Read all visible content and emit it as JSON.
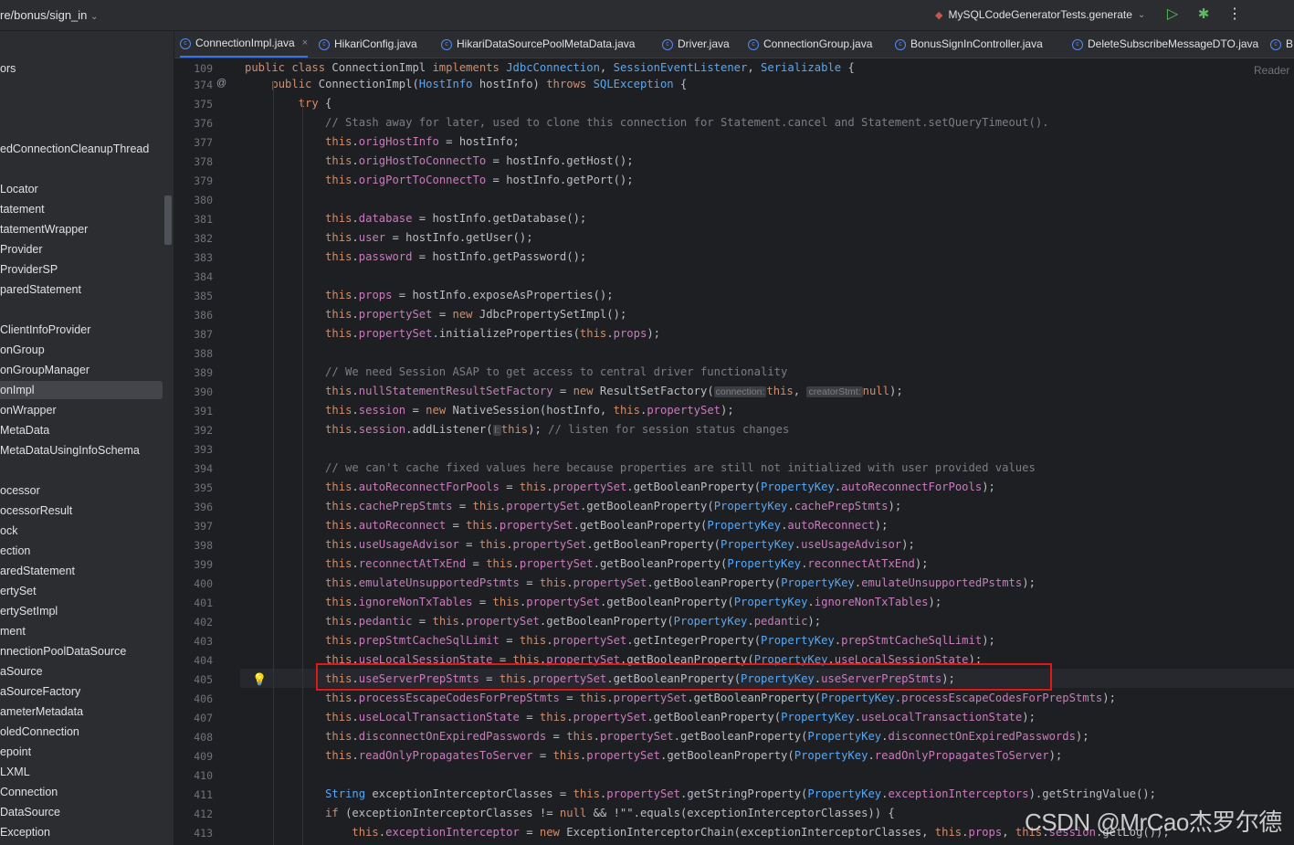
{
  "topbar": {
    "branch": "re/bonus/sign_in",
    "run_config": "MySQLCodeGeneratorTests.generate"
  },
  "sidebar": {
    "items": [
      "ors",
      "",
      "",
      "",
      "edConnectionCleanupThread",
      "",
      "Locator",
      "tatement",
      "tatementWrapper",
      "Provider",
      "ProviderSP",
      "paredStatement",
      "",
      "ClientInfoProvider",
      "onGroup",
      "onGroupManager",
      "onImpl",
      "onWrapper",
      "MetaData",
      "MetaDataUsingInfoSchema",
      "",
      "ocessor",
      "ocessorResult",
      "ock",
      "ection",
      "aredStatement",
      "ertySet",
      "ertySetImpl",
      "ment",
      "nnectionPoolDataSource",
      "aSource",
      "aSourceFactory",
      "ameterMetadata",
      "oledConnection",
      "epoint",
      "LXML",
      "Connection",
      "DataSource",
      "Exception"
    ],
    "selected_index": 16
  },
  "tabs": [
    {
      "label": "ConnectionImpl.java",
      "active": true
    },
    {
      "label": "HikariConfig.java",
      "active": false
    },
    {
      "label": "HikariDataSourcePoolMetaData.java",
      "active": false
    },
    {
      "label": "Driver.java",
      "active": false
    },
    {
      "label": "ConnectionGroup.java",
      "active": false
    },
    {
      "label": "BonusSignInController.java",
      "active": false
    },
    {
      "label": "DeleteSubscribeMessageDTO.java",
      "active": false
    },
    {
      "label": "B",
      "active": false
    }
  ],
  "editor": {
    "reader_mode": "Reader",
    "watermark": "CSDN @MrCao杰罗尔德",
    "lines": [
      {
        "n": "109",
        "text": "public class ConnectionImpl implements JdbcConnection, SessionEventListener, Serializable {"
      },
      {
        "n": "374",
        "text": "    public ConnectionImpl(HostInfo hostInfo) throws SQLException {"
      },
      {
        "n": "375",
        "text": "        try {"
      },
      {
        "n": "376",
        "text": "            // Stash away for later, used to clone this connection for Statement.cancel and Statement.setQueryTimeout()."
      },
      {
        "n": "377",
        "text": "            this.origHostInfo = hostInfo;"
      },
      {
        "n": "378",
        "text": "            this.origHostToConnectTo = hostInfo.getHost();"
      },
      {
        "n": "379",
        "text": "            this.origPortToConnectTo = hostInfo.getPort();"
      },
      {
        "n": "380",
        "text": ""
      },
      {
        "n": "381",
        "text": "            this.database = hostInfo.getDatabase();"
      },
      {
        "n": "382",
        "text": "            this.user = hostInfo.getUser();"
      },
      {
        "n": "383",
        "text": "            this.password = hostInfo.getPassword();"
      },
      {
        "n": "384",
        "text": ""
      },
      {
        "n": "385",
        "text": "            this.props = hostInfo.exposeAsProperties();"
      },
      {
        "n": "386",
        "text": "            this.propertySet = new JdbcPropertySetImpl();"
      },
      {
        "n": "387",
        "text": "            this.propertySet.initializeProperties(this.props);"
      },
      {
        "n": "388",
        "text": ""
      },
      {
        "n": "389",
        "text": "            // We need Session ASAP to get access to central driver functionality"
      },
      {
        "n": "390",
        "text": "            this.nullStatementResultSetFactory = new ResultSetFactory( connection: this,  creatorStmt: null);"
      },
      {
        "n": "391",
        "text": "            this.session = new NativeSession(hostInfo, this.propertySet);"
      },
      {
        "n": "392",
        "text": "            this.session.addListener( l: this); // listen for session status changes"
      },
      {
        "n": "393",
        "text": ""
      },
      {
        "n": "394",
        "text": "            // we can't cache fixed values here because properties are still not initialized with user provided values"
      },
      {
        "n": "395",
        "text": "            this.autoReconnectForPools = this.propertySet.getBooleanProperty(PropertyKey.autoReconnectForPools);"
      },
      {
        "n": "396",
        "text": "            this.cachePrepStmts = this.propertySet.getBooleanProperty(PropertyKey.cachePrepStmts);"
      },
      {
        "n": "397",
        "text": "            this.autoReconnect = this.propertySet.getBooleanProperty(PropertyKey.autoReconnect);"
      },
      {
        "n": "398",
        "text": "            this.useUsageAdvisor = this.propertySet.getBooleanProperty(PropertyKey.useUsageAdvisor);"
      },
      {
        "n": "399",
        "text": "            this.reconnectAtTxEnd = this.propertySet.getBooleanProperty(PropertyKey.reconnectAtTxEnd);"
      },
      {
        "n": "400",
        "text": "            this.emulateUnsupportedPstmts = this.propertySet.getBooleanProperty(PropertyKey.emulateUnsupportedPstmts);"
      },
      {
        "n": "401",
        "text": "            this.ignoreNonTxTables = this.propertySet.getBooleanProperty(PropertyKey.ignoreNonTxTables);"
      },
      {
        "n": "402",
        "text": "            this.pedantic = this.propertySet.getBooleanProperty(PropertyKey.pedantic);"
      },
      {
        "n": "403",
        "text": "            this.prepStmtCacheSqlLimit = this.propertySet.getIntegerProperty(PropertyKey.prepStmtCacheSqlLimit);"
      },
      {
        "n": "404",
        "text": "            this.useLocalSessionState = this.propertySet.getBooleanProperty(PropertyKey.useLocalSessionState);"
      },
      {
        "n": "405",
        "text": "            this.useServerPrepStmts = this.propertySet.getBooleanProperty(PropertyKey.useServerPrepStmts);"
      },
      {
        "n": "406",
        "text": "            this.processEscapeCodesForPrepStmts = this.propertySet.getBooleanProperty(PropertyKey.processEscapeCodesForPrepStmts);"
      },
      {
        "n": "407",
        "text": "            this.useLocalTransactionState = this.propertySet.getBooleanProperty(PropertyKey.useLocalTransactionState);"
      },
      {
        "n": "408",
        "text": "            this.disconnectOnExpiredPasswords = this.propertySet.getBooleanProperty(PropertyKey.disconnectOnExpiredPasswords);"
      },
      {
        "n": "409",
        "text": "            this.readOnlyPropagatesToServer = this.propertySet.getBooleanProperty(PropertyKey.readOnlyPropagatesToServer);"
      },
      {
        "n": "410",
        "text": ""
      },
      {
        "n": "411",
        "text": "            String exceptionInterceptorClasses = this.propertySet.getStringProperty(PropertyKey.exceptionInterceptors).getStringValue();"
      },
      {
        "n": "412",
        "text": "            if (exceptionInterceptorClasses != null && !\"\".equals(exceptionInterceptorClasses)) {"
      },
      {
        "n": "413",
        "text": "                this.exceptionInterceptor = new ExceptionInterceptorChain(exceptionInterceptorClasses, this.props, this.session.getLog());"
      }
    ]
  },
  "colors": {
    "keyword": "#cf8e6d",
    "field": "#c77dbb",
    "type": "#56a8f5",
    "comment": "#7a7e85",
    "highlight_box": "#e01818"
  }
}
